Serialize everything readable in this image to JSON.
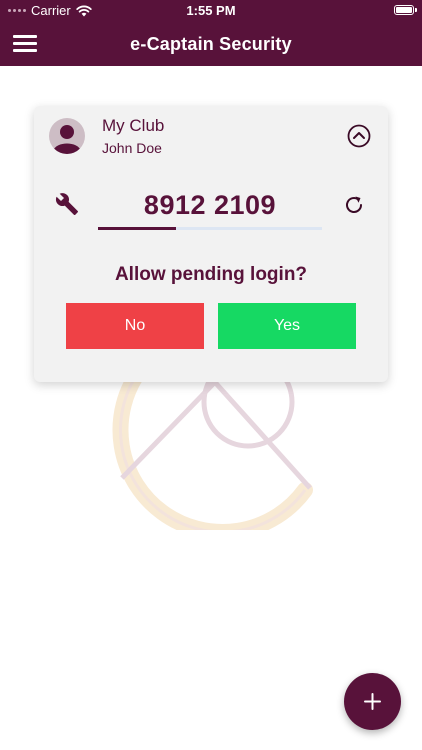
{
  "status_bar": {
    "carrier": "Carrier",
    "time": "1:55 PM"
  },
  "nav": {
    "title": "e-Captain Security",
    "menu_icon": "hamburger-menu-icon"
  },
  "card": {
    "club_name": "My Club",
    "user_name": "John Doe",
    "avatar_icon": "person-icon",
    "collapse_icon": "chevron-up-circle-icon",
    "tool_icon": "wrench-icon",
    "refresh_icon": "refresh-icon",
    "code": "8912 2109",
    "code_progress": 0.35,
    "prompt": "Allow pending login?",
    "no_label": "No",
    "yes_label": "Yes"
  },
  "fab": {
    "icon": "plus-icon"
  },
  "colors": {
    "brand": "#58123a",
    "no_button": "#ef4146",
    "yes_button": "#16d963",
    "card_background": "#f2f2f2",
    "progress_track": "#dde6f3"
  }
}
